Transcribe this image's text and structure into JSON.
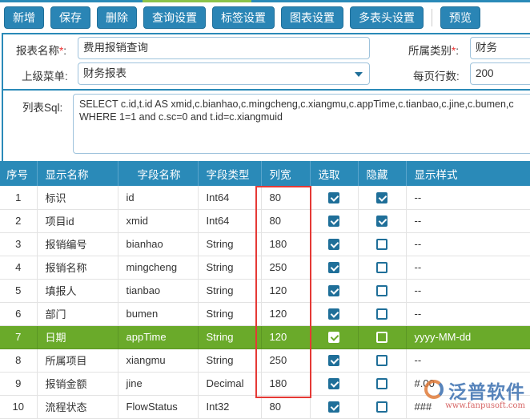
{
  "toolbar": {
    "buttons": [
      "新增",
      "保存",
      "删除",
      "查询设置",
      "标签设置",
      "图表设置",
      "多表头设置"
    ],
    "preview": "预览"
  },
  "form": {
    "report_name_label": "报表名称",
    "report_name": "费用报销查询",
    "category_label": "所属类别",
    "category": "财务",
    "parent_menu_label": "上级菜单",
    "parent_menu": "财务报表",
    "rows_per_page_label": "每页行数",
    "rows_per_page": "200",
    "sql_label": "列表Sql:",
    "sql": "SELECT c.id,t.id AS xmid,c.bianhao,c.mingcheng,c.xiangmu,c.appTime,c.tianbao,c.jine,c.bumen,c\nWHERE 1=1 and c.sc=0 and t.id=c.xiangmuid",
    "required_mark": "*",
    "colon": ":"
  },
  "table": {
    "headers": [
      "序号",
      "显示名称",
      "字段名称",
      "字段类型",
      "列宽",
      "选取",
      "隐藏",
      "显示样式"
    ],
    "rows": [
      {
        "no": "1",
        "display": "标识",
        "field": "id",
        "type": "Int64",
        "width": "80",
        "pick": true,
        "hide": true,
        "style": "--"
      },
      {
        "no": "2",
        "display": "项目id",
        "field": "xmid",
        "type": "Int64",
        "width": "80",
        "pick": true,
        "hide": true,
        "style": "--"
      },
      {
        "no": "3",
        "display": "报销编号",
        "field": "bianhao",
        "type": "String",
        "width": "180",
        "pick": true,
        "hide": false,
        "style": "--"
      },
      {
        "no": "4",
        "display": "报销名称",
        "field": "mingcheng",
        "type": "String",
        "width": "250",
        "pick": true,
        "hide": false,
        "style": "--"
      },
      {
        "no": "5",
        "display": "填报人",
        "field": "tianbao",
        "type": "String",
        "width": "120",
        "pick": true,
        "hide": false,
        "style": "--"
      },
      {
        "no": "6",
        "display": "部门",
        "field": "bumen",
        "type": "String",
        "width": "120",
        "pick": true,
        "hide": false,
        "style": "--"
      },
      {
        "no": "7",
        "display": "日期",
        "field": "appTime",
        "type": "String",
        "width": "120",
        "pick": true,
        "hide": false,
        "style": "yyyy-MM-dd",
        "selected": true
      },
      {
        "no": "8",
        "display": "所属项目",
        "field": "xiangmu",
        "type": "String",
        "width": "250",
        "pick": true,
        "hide": false,
        "style": "--"
      },
      {
        "no": "9",
        "display": "报销金额",
        "field": "jine",
        "type": "Decimal",
        "width": "180",
        "pick": true,
        "hide": false,
        "style": "#.00"
      },
      {
        "no": "10",
        "display": "流程状态",
        "field": "FlowStatus",
        "type": "Int32",
        "width": "80",
        "pick": true,
        "hide": false,
        "style": "###"
      }
    ]
  },
  "watermark": {
    "name": "泛普软件",
    "url": "www.fanpusoft.com"
  },
  "colors": {
    "primary": "#2a8ab8",
    "selected_row": "#6aaa2a",
    "highlight_box": "#e53935"
  }
}
